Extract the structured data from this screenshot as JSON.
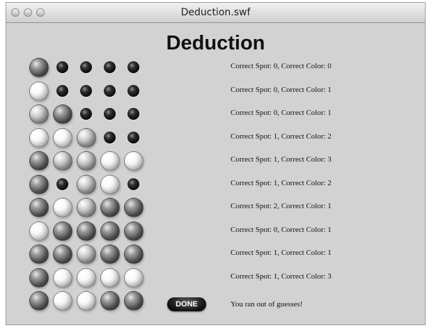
{
  "window": {
    "title": "Deduction.swf"
  },
  "game": {
    "title": "Deduction",
    "rows": [
      {
        "pegs": [
          "dark",
          "hole",
          "hole",
          "hole",
          "hole"
        ],
        "feedback": "Correct Spot: 0, Correct Color: 0"
      },
      {
        "pegs": [
          "light",
          "hole",
          "hole",
          "hole",
          "hole"
        ],
        "feedback": "Correct Spot: 0, Correct Color: 1"
      },
      {
        "pegs": [
          "mid",
          "dark",
          "hole",
          "hole",
          "hole"
        ],
        "feedback": "Correct Spot: 0, Correct Color: 1"
      },
      {
        "pegs": [
          "light",
          "light",
          "mid",
          "hole",
          "hole"
        ],
        "feedback": "Correct Spot: 1, Correct Color: 2"
      },
      {
        "pegs": [
          "dark",
          "mid",
          "mid",
          "light",
          "light"
        ],
        "feedback": "Correct Spot: 1, Correct Color: 3"
      },
      {
        "pegs": [
          "dark",
          "hole",
          "mid",
          "light",
          "hole"
        ],
        "feedback": "Correct Spot: 1, Correct Color: 2"
      },
      {
        "pegs": [
          "dark",
          "light",
          "mid",
          "dark",
          "dark"
        ],
        "feedback": "Correct Spot: 2, Correct Color: 1"
      },
      {
        "pegs": [
          "light",
          "dark",
          "dark",
          "dark",
          "dark"
        ],
        "feedback": "Correct Spot: 0, Correct Color: 1"
      },
      {
        "pegs": [
          "dark",
          "dark",
          "mid",
          "dark",
          "dark"
        ],
        "feedback": "Correct Spot: 1, Correct Color: 1"
      },
      {
        "pegs": [
          "dark",
          "light",
          "light",
          "light",
          "light"
        ],
        "feedback": "Correct Spot: 1, Correct Color: 3"
      },
      {
        "pegs": [
          "dark",
          "light",
          "light",
          "dark",
          "dark"
        ],
        "feedback": ""
      }
    ],
    "done_label": "DONE",
    "status_text": "You ran out of guesses!"
  },
  "peg_colors": {
    "light": "#f4f4f4",
    "mid": "#a0a0a0",
    "dark": "#5a5a5a",
    "hole": "#111111"
  }
}
